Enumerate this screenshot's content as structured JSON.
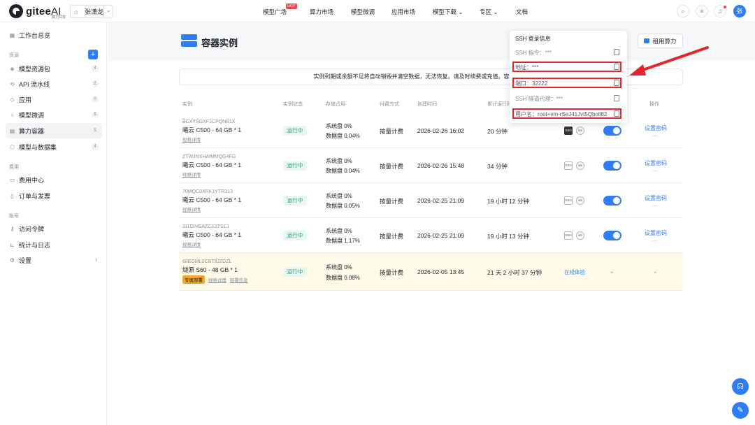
{
  "topbar": {
    "logo": "gitee",
    "logo_ai": "AI",
    "logo_sub": "算力共享",
    "workspace": "张潇龙",
    "nav": [
      "模型广场",
      "算力市场",
      "模型微调",
      "应用市场",
      "模型下载",
      "专区",
      "文档"
    ],
    "hot_badge": "HOT",
    "avatar": "张"
  },
  "sidebar": {
    "overview": "工作台总览",
    "section_resources": "资源",
    "items": [
      {
        "label": "模型资源包",
        "count": "4"
      },
      {
        "label": "API 流水线",
        "count": "2"
      },
      {
        "label": "应用",
        "count": "0"
      },
      {
        "label": "模型微调",
        "count": "5"
      },
      {
        "label": "算力容器",
        "count": "5"
      },
      {
        "label": "模型与数据集",
        "count": "4"
      }
    ],
    "section_billing": "费用",
    "billing": [
      "费用中心",
      "订单与发票"
    ],
    "section_account": "账号",
    "account": [
      "访问令牌",
      "统计与日志",
      "设置"
    ]
  },
  "page": {
    "title": "容器实例",
    "rent_button": "租用算力",
    "notice": "实例到期或余额不足将自动销毁并清空数据，无法恢复。请及时续费或充值。容器访问与数据持"
  },
  "table": {
    "headers": [
      "实例",
      "实例状态",
      "存储占用",
      "付费方式",
      "创建时间",
      "累计运行时",
      "操作"
    ],
    "rows": [
      {
        "id": "BCXYSGXF1CPQNE1X",
        "name": "曦云 C500 - 64 GB * 1",
        "spec": "规格详情",
        "status": "运行中",
        "sys": "系统盘 0%",
        "data": "数据盘 0.04%",
        "pay": "按量计费",
        "created": "2026-02-26 16:02",
        "runtime": "20 分钟",
        "action": "设置密码",
        "more": "···"
      },
      {
        "id": "ZTWJNXHAIMMQG4FG",
        "name": "曦云 C500 - 64 GB * 1",
        "spec": "规格详情",
        "status": "运行中",
        "sys": "系统盘 0%",
        "data": "数据盘 0.04%",
        "pay": "按量计费",
        "created": "2026-02-26 15:48",
        "runtime": "34 分钟",
        "action": "设置密码",
        "more": "···"
      },
      {
        "id": "70MQC0XRK1YTR313",
        "name": "曦云 C500 - 64 GB * 1",
        "spec": "规格详情",
        "status": "运行中",
        "sys": "系统盘 0%",
        "data": "数据盘 0.05%",
        "pay": "按量计费",
        "created": "2026-02-25 21:09",
        "runtime": "19 小时 12 分钟",
        "action": "设置密码",
        "more": "···"
      },
      {
        "id": "SI1OIVEAZCX3TS1J",
        "name": "曦云 C500 - 64 GB * 1",
        "spec": "规格详情",
        "status": "运行中",
        "sys": "系统盘 0%",
        "data": "数据盘 1.17%",
        "pay": "按量计费",
        "created": "2026-02-25 21:09",
        "runtime": "19 小时 13 分钟",
        "action": "设置密码",
        "more": "···"
      },
      {
        "id": "68EGML0CBT9JZDZL",
        "name": "燧原 S60 - 48 GB * 1",
        "tag": "专属部署",
        "spec": "规格详情",
        "deploy": "部署信息",
        "status": "运行中",
        "sys": "系统盘 0%",
        "data": "数据盘 0.08%",
        "pay": "按量计费",
        "created": "2026-02-05 13:45",
        "runtime": "21 天 2 小时 37 分钟",
        "online": "在线体验",
        "dash1": "-",
        "dash2": "-"
      }
    ],
    "ssh_label": "SSH",
    "lab_label": "lab"
  },
  "ssh_popup": {
    "title": "SSH 登录信息",
    "cmd": "SSH 指令：***",
    "addr": "地址：***",
    "port": "端口：32222",
    "proxy": "SSH 隧道代理：***",
    "user": "用户名：root+vm-rSeJ41Jvt5Qboll82"
  },
  "colors": {
    "accent": "#2f7df6",
    "highlight_box": "#e5242b"
  }
}
